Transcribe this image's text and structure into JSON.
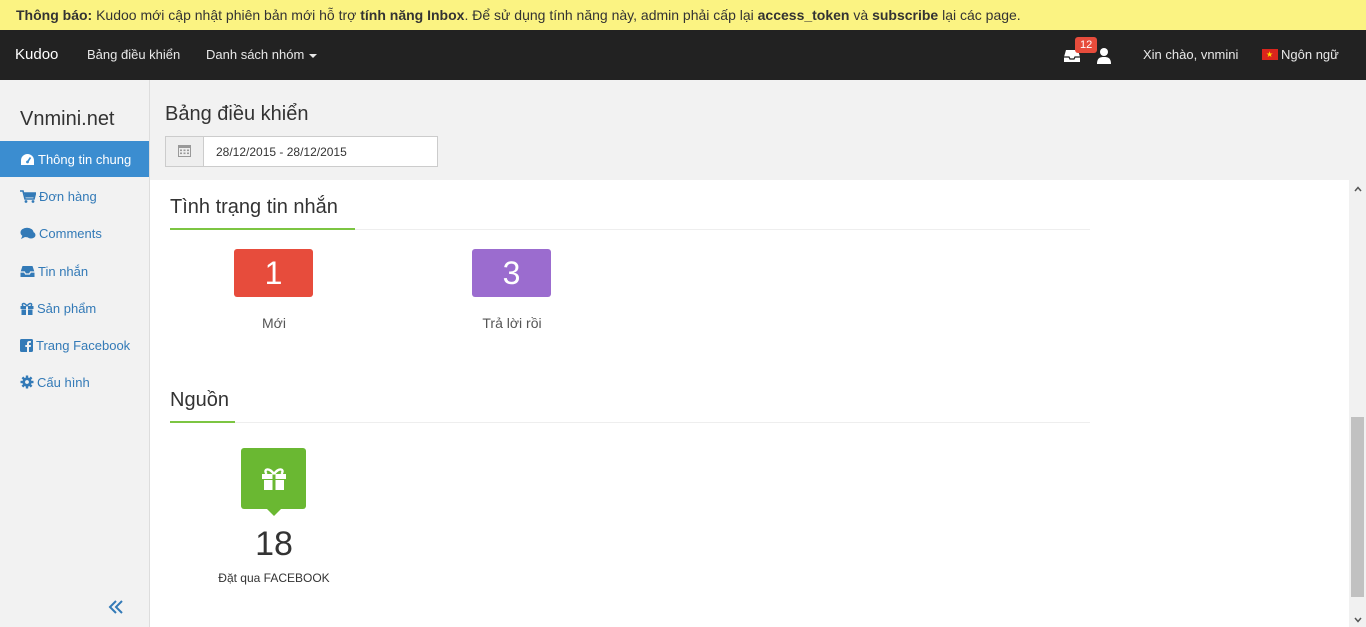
{
  "notice": {
    "label": "Thông báo:",
    "part1": " Kudoo mới cập nhật phiên bản mới hỗ trợ ",
    "feature": "tính năng Inbox",
    "part2": ". Để sử dụng tính năng này, admin phải cấp lại ",
    "token": "access_token",
    "and": " và ",
    "subscribe": "subscribe",
    "part3": " lại các page."
  },
  "navbar": {
    "brand": "Kudoo",
    "dashboard": "Bảng điều khiển",
    "groups": "Danh sách nhóm",
    "inbox_badge": "12",
    "greeting": "Xin chào, vnmini",
    "language": "Ngôn ngữ"
  },
  "sidebar": {
    "site_name": "Vnmini.net",
    "items": [
      {
        "label": "Thông tin chung",
        "icon": "dashboard-icon"
      },
      {
        "label": "Đơn hàng",
        "icon": "cart-icon"
      },
      {
        "label": "Comments",
        "icon": "comments-icon"
      },
      {
        "label": "Tin nhắn",
        "icon": "inbox-icon"
      },
      {
        "label": "Sản phẩm",
        "icon": "gift-icon"
      },
      {
        "label": "Trang Facebook",
        "icon": "facebook-icon"
      },
      {
        "label": "Cấu hình",
        "icon": "gear-icon"
      }
    ],
    "collapse": "«"
  },
  "main": {
    "title": "Bảng điều khiển",
    "date_range": "28/12/2015 - 28/12/2015"
  },
  "messages": {
    "title": "Tình trạng tin nhắn",
    "new_count": "1",
    "new_label": "Mới",
    "new_color": "#e74c3c",
    "replied_count": "3",
    "replied_label": "Trả lời rồi",
    "replied_color": "#9b6ccf"
  },
  "sources": {
    "title": "Nguồn",
    "count": "18",
    "label": "Đặt qua FACEBOOK",
    "color": "#6ab832",
    "icon": "gift-icon"
  }
}
